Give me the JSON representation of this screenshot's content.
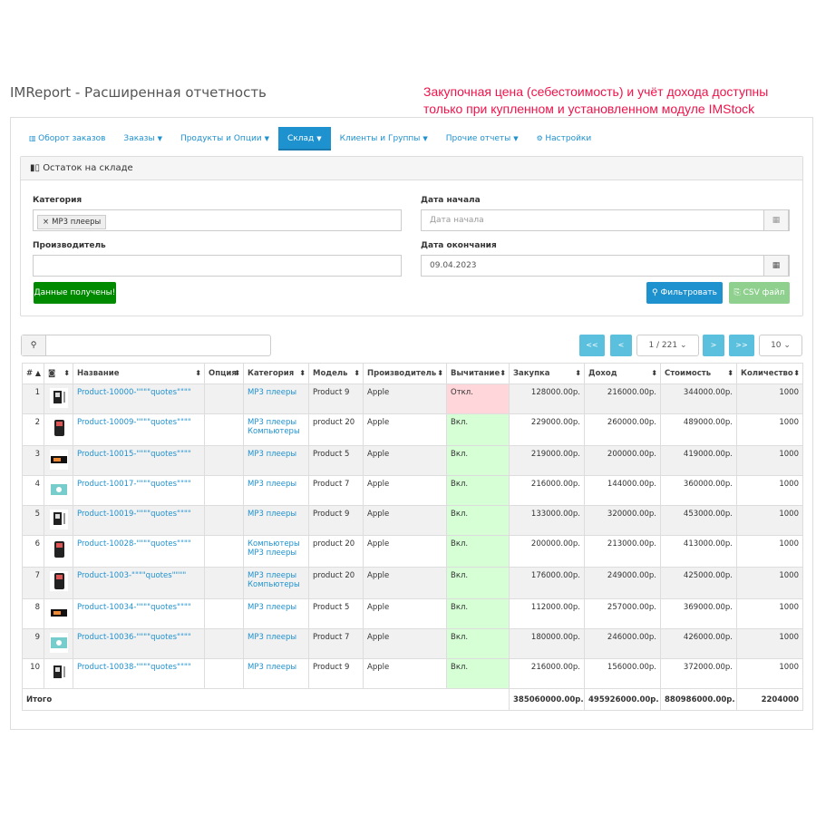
{
  "header": {
    "title": "IMReport - Расширенная отчетность",
    "notice_line1": "Закупочная цена (себестоимость) и учёт дохода доступны",
    "notice_line2": "только при купленном и установленном модуле IMStock"
  },
  "nav": [
    {
      "label": "Оборот заказов",
      "icon": "bar-chart-icon"
    },
    {
      "label": "Заказы",
      "caret": true
    },
    {
      "label": "Продукты и Опции",
      "caret": true
    },
    {
      "label": "Склад",
      "caret": true,
      "active": true
    },
    {
      "label": "Клиенты и Группы",
      "caret": true
    },
    {
      "label": "Прочие отчеты",
      "caret": true
    },
    {
      "label": "Настройки",
      "icon": "gears-icon"
    }
  ],
  "report": {
    "title": "Остаток на складе"
  },
  "filters": {
    "category_label": "Категория",
    "category_tag": "MP3 плееры",
    "manufacturer_label": "Производитель",
    "manufacturer_value": "",
    "date_start_label": "Дата начала",
    "date_start_placeholder": "Дата начала",
    "date_end_label": "Дата окончания",
    "date_end_value": "09.04.2023",
    "status_button": "Данные получены!",
    "filter_button": "Фильтровать",
    "csv_button": "CSV файл"
  },
  "colors": {
    "accent": "#1e91cf",
    "green": "#008a00",
    "csv": "#8fd08f",
    "off": "#ffd6d9",
    "on": "#d6ffd6",
    "notice": "#f0134a"
  },
  "pagination": {
    "first": "<<",
    "prev": "<",
    "page": "1 / 221",
    "next": ">",
    "last": ">>",
    "per_page": "10"
  },
  "table": {
    "headers": [
      "#",
      "",
      "Название",
      "Опция",
      "Категория",
      "Модель",
      "Производитель",
      "Вычитание",
      "Закупка",
      "Доход",
      "Стоимость",
      "Количество"
    ],
    "rows": [
      {
        "n": "1",
        "thumb": "ipod",
        "name": "Product-10000-\"\"\"\"quotes\"\"\"\"",
        "option": "",
        "cat1": "MP3 плееры",
        "cat2": "",
        "model": "Product 9",
        "mfr": "Apple",
        "sub": "Откл.",
        "buy": "128000.00р.",
        "income": "216000.00р.",
        "cost": "344000.00р.",
        "qty": "1000"
      },
      {
        "n": "2",
        "thumb": "player",
        "name": "Product-10009-\"\"\"\"quotes\"\"\"\"",
        "option": "",
        "cat1": "MP3 плееры",
        "cat2": "Компьютеры",
        "model": "product 20",
        "mfr": "Apple",
        "sub": "Вкл.",
        "buy": "229000.00р.",
        "income": "260000.00р.",
        "cost": "489000.00р.",
        "qty": "1000"
      },
      {
        "n": "3",
        "thumb": "shuffle",
        "name": "Product-10015-\"\"\"\"quotes\"\"\"\"",
        "option": "",
        "cat1": "MP3 плееры",
        "cat2": "",
        "model": "Product 5",
        "mfr": "Apple",
        "sub": "Вкл.",
        "buy": "219000.00р.",
        "income": "200000.00р.",
        "cost": "419000.00р.",
        "qty": "1000"
      },
      {
        "n": "4",
        "thumb": "camera",
        "name": "Product-10017-\"\"\"\"quotes\"\"\"\"",
        "option": "",
        "cat1": "MP3 плееры",
        "cat2": "",
        "model": "Product 7",
        "mfr": "Apple",
        "sub": "Вкл.",
        "buy": "216000.00р.",
        "income": "144000.00р.",
        "cost": "360000.00р.",
        "qty": "1000"
      },
      {
        "n": "5",
        "thumb": "ipod",
        "name": "Product-10019-\"\"\"\"quotes\"\"\"\"",
        "option": "",
        "cat1": "MP3 плееры",
        "cat2": "",
        "model": "Product 9",
        "mfr": "Apple",
        "sub": "Вкл.",
        "buy": "133000.00р.",
        "income": "320000.00р.",
        "cost": "453000.00р.",
        "qty": "1000"
      },
      {
        "n": "6",
        "thumb": "player",
        "name": "Product-10028-\"\"\"\"quotes\"\"\"\"",
        "option": "",
        "cat1": "Компьютеры",
        "cat2": "MP3 плееры",
        "model": "product 20",
        "mfr": "Apple",
        "sub": "Вкл.",
        "buy": "200000.00р.",
        "income": "213000.00р.",
        "cost": "413000.00р.",
        "qty": "1000"
      },
      {
        "n": "7",
        "thumb": "player",
        "name": "Product-1003-\"\"\"\"quotes\"\"\"\"",
        "option": "",
        "cat1": "MP3 плееры",
        "cat2": "Компьютеры",
        "model": "product 20",
        "mfr": "Apple",
        "sub": "Вкл.",
        "buy": "176000.00р.",
        "income": "249000.00р.",
        "cost": "425000.00р.",
        "qty": "1000"
      },
      {
        "n": "8",
        "thumb": "shuffle",
        "name": "Product-10034-\"\"\"\"quotes\"\"\"\"",
        "option": "",
        "cat1": "MP3 плееры",
        "cat2": "",
        "model": "Product 5",
        "mfr": "Apple",
        "sub": "Вкл.",
        "buy": "112000.00р.",
        "income": "257000.00р.",
        "cost": "369000.00р.",
        "qty": "1000"
      },
      {
        "n": "9",
        "thumb": "camera",
        "name": "Product-10036-\"\"\"\"quotes\"\"\"\"",
        "option": "",
        "cat1": "MP3 плееры",
        "cat2": "",
        "model": "Product 7",
        "mfr": "Apple",
        "sub": "Вкл.",
        "buy": "180000.00р.",
        "income": "246000.00р.",
        "cost": "426000.00р.",
        "qty": "1000"
      },
      {
        "n": "10",
        "thumb": "ipod",
        "name": "Product-10038-\"\"\"\"quotes\"\"\"\"",
        "option": "",
        "cat1": "MP3 плееры",
        "cat2": "",
        "model": "Product 9",
        "mfr": "Apple",
        "sub": "Вкл.",
        "buy": "216000.00р.",
        "income": "156000.00р.",
        "cost": "372000.00р.",
        "qty": "1000"
      }
    ],
    "totals": {
      "label": "Итого",
      "buy": "385060000.00р.",
      "income": "495926000.00р.",
      "cost": "880986000.00р.",
      "qty": "2204000"
    }
  }
}
